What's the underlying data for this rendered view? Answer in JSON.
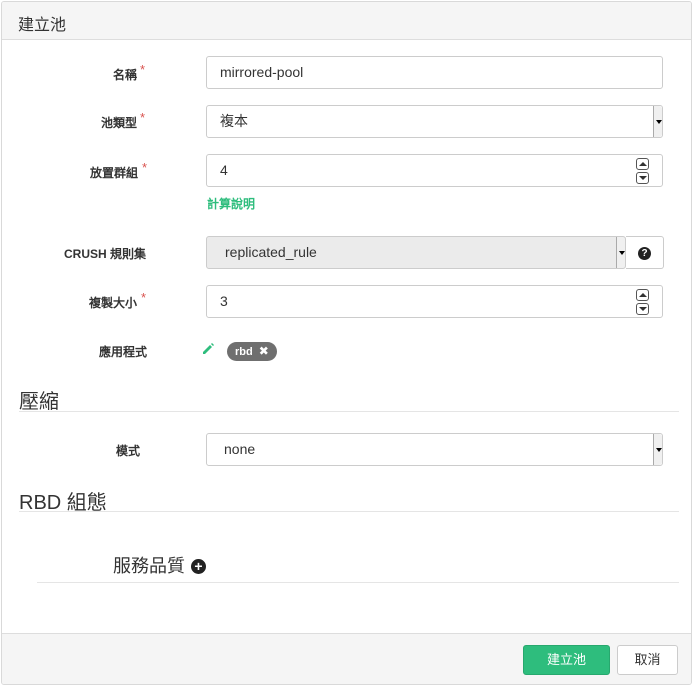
{
  "header": {
    "title": "建立池"
  },
  "form": {
    "name": {
      "label": "名稱",
      "required_mark": "*",
      "value": "mirrored-pool"
    },
    "pool_type": {
      "label": "池類型",
      "required_mark": "*",
      "value": "複本"
    },
    "pg": {
      "label": "放置群組",
      "required_mark": "*",
      "value": "4",
      "help_link": "計算說明"
    },
    "crush": {
      "label": "CRUSH 規則集",
      "value": "replicated_rule"
    },
    "size": {
      "label": "複製大小",
      "required_mark": "*",
      "value": "3"
    },
    "applications": {
      "label": "應用程式",
      "tags": [
        "rbd"
      ],
      "remove_glyph": "✖"
    }
  },
  "compression": {
    "title": "壓縮",
    "mode": {
      "label": "模式",
      "value": "none"
    }
  },
  "rbd": {
    "title": "RBD 組態",
    "qos": {
      "title": "服務品質",
      "add_glyph": "+"
    }
  },
  "footer": {
    "create_label": "建立池",
    "cancel_label": "取消"
  },
  "icons": {
    "help": "question-circle-icon",
    "edit": "pencil-icon",
    "add": "plus-circle-icon"
  },
  "colors": {
    "accent": "#2ebd7d",
    "required": "#d9534f",
    "tag_bg": "#6f6f6f"
  }
}
